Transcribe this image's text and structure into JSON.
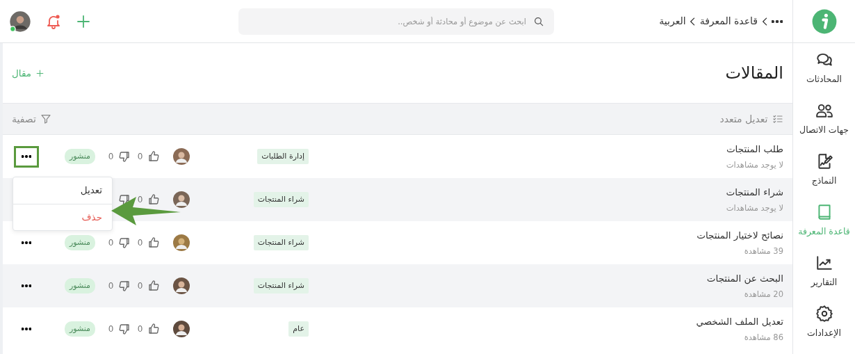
{
  "sidebar": {
    "items": [
      {
        "label": "المحادثات",
        "selected": false
      },
      {
        "label": "جهات الاتصال",
        "selected": false
      },
      {
        "label": "النماذج",
        "selected": false
      },
      {
        "label": "قاعدة المعرفة",
        "selected": true
      },
      {
        "label": "التقارير",
        "selected": false
      },
      {
        "label": "الإعدادات",
        "selected": false
      }
    ]
  },
  "topbar": {
    "breadcrumb": [
      "قاعدة المعرفة",
      "العربية"
    ],
    "search": {
      "placeholder": "ابحث عن موضوع أو محادثة أو شخص.."
    },
    "notifications": {
      "unread": true
    },
    "user": {
      "online": true
    }
  },
  "page": {
    "title": "المقالات",
    "add_button": "مقال"
  },
  "toolbar": {
    "bulk_edit": "تعديل متعدد",
    "filter": "تصفية"
  },
  "articles": [
    {
      "title": "طلب المنتجات",
      "views": "لا يوجد مشاهدات",
      "category": "إدارة الطلبات",
      "likes": "0",
      "dislikes": "0",
      "status": "منشور",
      "menu": {
        "highlighted": true
      }
    },
    {
      "title": "شراء المنتجات",
      "views": "لا يوجد مشاهدات",
      "category": "شراء المنتجات",
      "likes": "0"
    },
    {
      "title": "نصائح لاختيار المنتجات",
      "views": "39 مشاهدة",
      "category": "شراء المنتجات",
      "likes": "0",
      "dislikes": "0",
      "status": "منشور",
      "menu": {
        "highlighted": false
      }
    },
    {
      "title": "البحث عن المنتجات",
      "views": "20 مشاهدة",
      "category": "شراء المنتجات",
      "likes": "0",
      "dislikes": "0",
      "status": "منشور",
      "menu": {
        "highlighted": false
      }
    },
    {
      "title": "تعديل الملف الشخصي",
      "views": "86 مشاهدة",
      "category": "عام",
      "likes": "0",
      "dislikes": "0",
      "status": "منشور",
      "menu": {
        "highlighted": false
      }
    }
  ],
  "dropdown": {
    "items": [
      {
        "label": "تعديل",
        "kind": "normal"
      },
      {
        "label": "حذف",
        "kind": "danger"
      }
    ]
  }
}
